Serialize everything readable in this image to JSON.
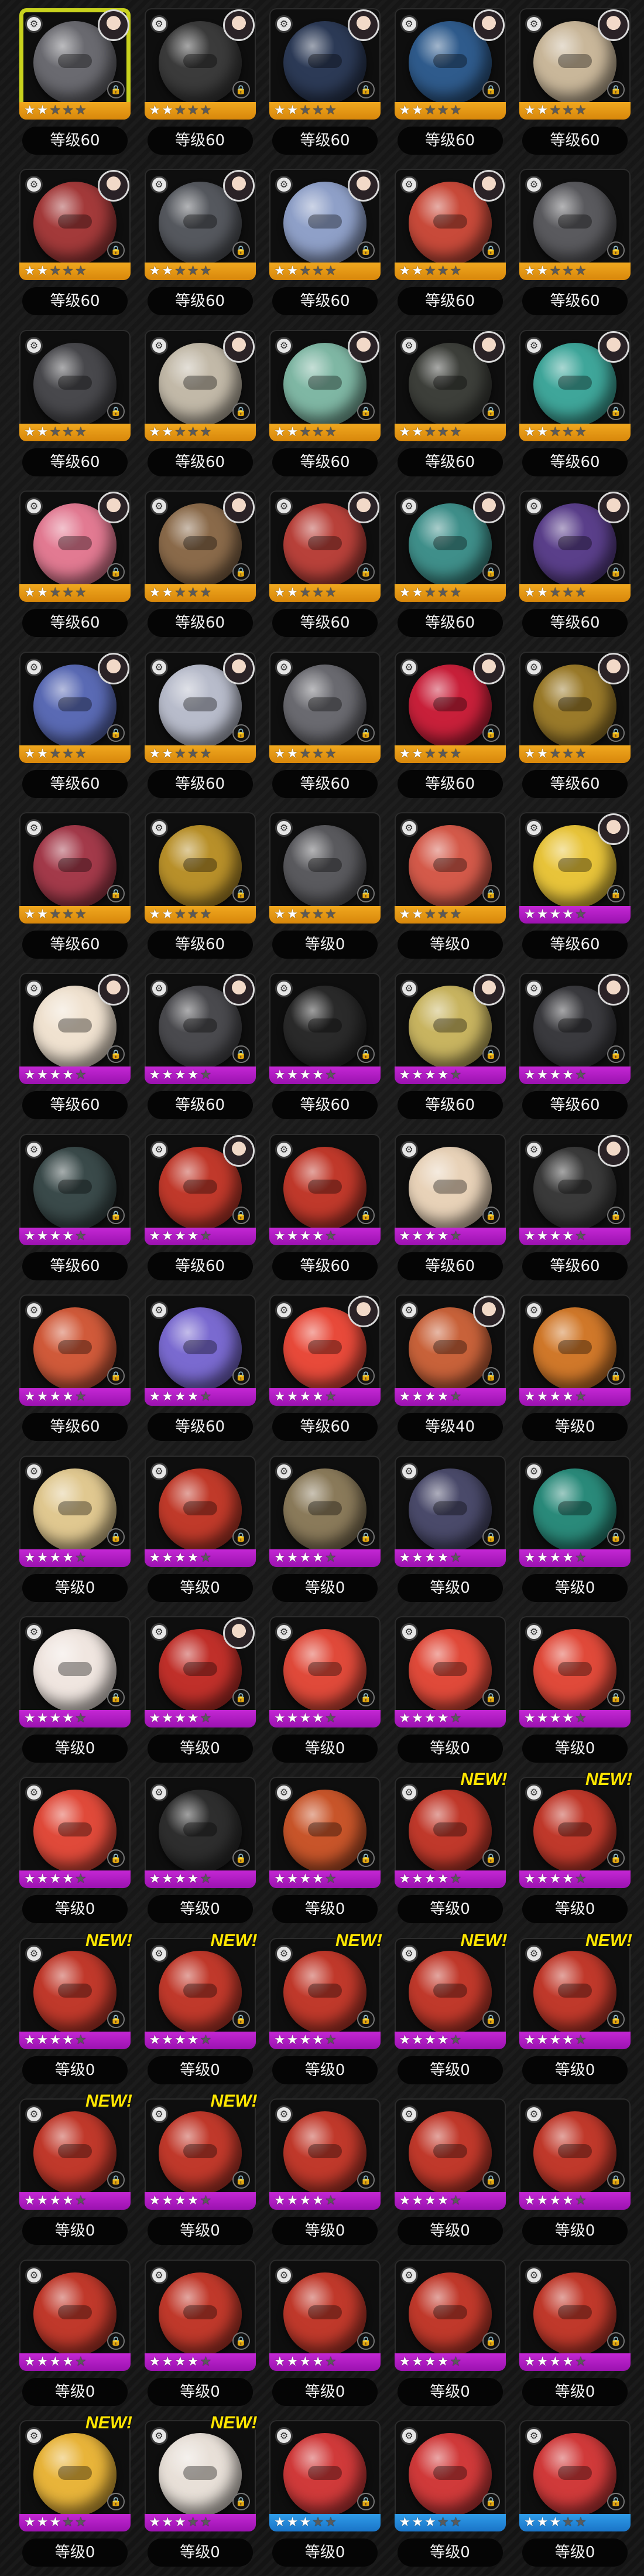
{
  "colors": {
    "selection_border": "#c8d21e",
    "rarity_orange": "#f0a81f",
    "rarity_purple": "#c427d4",
    "rarity_blue": "#2f9dea",
    "new_badge": "#ffe600"
  },
  "new_badge_text": "NEW!",
  "icons": {
    "type": "type-icon",
    "lock": "lock-icon",
    "star": "star-icon",
    "avatar": "character-avatar"
  },
  "items": [
    {
      "level": "等级60",
      "rarity": "orange",
      "stars": 2,
      "avatar": true,
      "new": false,
      "selected": true,
      "art": "#6a6a70"
    },
    {
      "level": "等级60",
      "rarity": "orange",
      "stars": 2,
      "avatar": true,
      "new": false,
      "art": "#3b3b3b"
    },
    {
      "level": "等级60",
      "rarity": "orange",
      "stars": 2,
      "avatar": true,
      "new": false,
      "art": "#2c3a56"
    },
    {
      "level": "等级60",
      "rarity": "orange",
      "stars": 2,
      "avatar": true,
      "new": false,
      "art": "#2f5b8c"
    },
    {
      "level": "等级60",
      "rarity": "orange",
      "stars": 2,
      "avatar": true,
      "new": false,
      "art": "#c9b79a"
    },
    {
      "level": "等级60",
      "rarity": "orange",
      "stars": 2,
      "avatar": true,
      "new": false,
      "art": "#a33a3a"
    },
    {
      "level": "等级60",
      "rarity": "orange",
      "stars": 2,
      "avatar": true,
      "new": false,
      "art": "#55585e"
    },
    {
      "level": "等级60",
      "rarity": "orange",
      "stars": 2,
      "avatar": true,
      "new": false,
      "art": "#8fa0c8"
    },
    {
      "level": "等级60",
      "rarity": "orange",
      "stars": 2,
      "avatar": true,
      "new": false,
      "art": "#c84a3a"
    },
    {
      "level": "等级60",
      "rarity": "orange",
      "stars": 2,
      "avatar": false,
      "new": false,
      "art": "#5a5a5e"
    },
    {
      "level": "等级60",
      "rarity": "orange",
      "stars": 2,
      "avatar": false,
      "new": false,
      "art": "#48484c"
    },
    {
      "level": "等级60",
      "rarity": "orange",
      "stars": 2,
      "avatar": true,
      "new": false,
      "art": "#c2b9a8"
    },
    {
      "level": "等级60",
      "rarity": "orange",
      "stars": 2,
      "avatar": true,
      "new": false,
      "art": "#7fb7a4"
    },
    {
      "level": "等级60",
      "rarity": "orange",
      "stars": 2,
      "avatar": true,
      "new": false,
      "art": "#3d3f3a"
    },
    {
      "level": "等级60",
      "rarity": "orange",
      "stars": 2,
      "avatar": true,
      "new": false,
      "art": "#3fa69a"
    },
    {
      "level": "等级60",
      "rarity": "orange",
      "stars": 2,
      "avatar": true,
      "new": false,
      "art": "#e27a92"
    },
    {
      "level": "等级60",
      "rarity": "orange",
      "stars": 2,
      "avatar": true,
      "new": false,
      "art": "#8a6a4a"
    },
    {
      "level": "等级60",
      "rarity": "orange",
      "stars": 2,
      "avatar": true,
      "new": false,
      "art": "#b8413a"
    },
    {
      "level": "等级60",
      "rarity": "orange",
      "stars": 2,
      "avatar": true,
      "new": false,
      "art": "#3f8f8a"
    },
    {
      "level": "等级60",
      "rarity": "orange",
      "stars": 2,
      "avatar": true,
      "new": false,
      "art": "#5a3f8a"
    },
    {
      "level": "等级60",
      "rarity": "orange",
      "stars": 2,
      "avatar": true,
      "new": false,
      "art": "#5a6ab4"
    },
    {
      "level": "等级60",
      "rarity": "orange",
      "stars": 2,
      "avatar": true,
      "new": false,
      "art": "#b8bccb"
    },
    {
      "level": "等级60",
      "rarity": "orange",
      "stars": 2,
      "avatar": false,
      "new": false,
      "art": "#6a6a70"
    },
    {
      "level": "等级60",
      "rarity": "orange",
      "stars": 2,
      "avatar": true,
      "new": false,
      "art": "#c8203a"
    },
    {
      "level": "等级60",
      "rarity": "orange",
      "stars": 2,
      "avatar": true,
      "new": false,
      "art": "#9a7a2a"
    },
    {
      "level": "等级60",
      "rarity": "orange",
      "stars": 2,
      "avatar": false,
      "new": false,
      "art": "#a33a4a"
    },
    {
      "level": "等级60",
      "rarity": "orange",
      "stars": 2,
      "avatar": false,
      "new": false,
      "art": "#b8902a"
    },
    {
      "level": "等级0",
      "rarity": "orange",
      "stars": 2,
      "avatar": false,
      "new": false,
      "art": "#5a5a5e"
    },
    {
      "level": "等级0",
      "rarity": "orange",
      "stars": 2,
      "avatar": false,
      "new": false,
      "art": "#d45a4a"
    },
    {
      "level": "等级60",
      "rarity": "purple",
      "stars": 4,
      "avatar": true,
      "new": false,
      "art": "#e8c43a"
    },
    {
      "level": "等级60",
      "rarity": "purple",
      "stars": 4,
      "avatar": true,
      "new": false,
      "art": "#f0e2d0"
    },
    {
      "level": "等级60",
      "rarity": "purple",
      "stars": 4,
      "avatar": true,
      "new": false,
      "art": "#4a4a4e"
    },
    {
      "level": "等级60",
      "rarity": "purple",
      "stars": 4,
      "avatar": false,
      "new": false,
      "art": "#2a2a2a"
    },
    {
      "level": "等级60",
      "rarity": "purple",
      "stars": 4,
      "avatar": true,
      "new": false,
      "art": "#c8b460"
    },
    {
      "level": "等级60",
      "rarity": "purple",
      "stars": 4,
      "avatar": true,
      "new": false,
      "art": "#3a3a3e"
    },
    {
      "level": "等级60",
      "rarity": "purple",
      "stars": 4,
      "avatar": false,
      "new": false,
      "art": "#3a4a4a"
    },
    {
      "level": "等级60",
      "rarity": "purple",
      "stars": 4,
      "avatar": true,
      "new": false,
      "art": "#c0392b"
    },
    {
      "level": "等级60",
      "rarity": "purple",
      "stars": 4,
      "avatar": false,
      "new": false,
      "art": "#c0392b"
    },
    {
      "level": "等级60",
      "rarity": "purple",
      "stars": 4,
      "avatar": false,
      "new": false,
      "art": "#e8d2b8"
    },
    {
      "level": "等级60",
      "rarity": "purple",
      "stars": 4,
      "avatar": true,
      "new": false,
      "art": "#3a3a3a"
    },
    {
      "level": "等级60",
      "rarity": "purple",
      "stars": 4,
      "avatar": false,
      "new": false,
      "art": "#d05a3a"
    },
    {
      "level": "等级60",
      "rarity": "purple",
      "stars": 4,
      "avatar": false,
      "new": false,
      "art": "#7a6ad0"
    },
    {
      "level": "等级60",
      "rarity": "purple",
      "stars": 4,
      "avatar": true,
      "new": false,
      "art": "#e84a3a"
    },
    {
      "level": "等级40",
      "rarity": "purple",
      "stars": 4,
      "avatar": true,
      "new": false,
      "art": "#c8623a"
    },
    {
      "level": "等级0",
      "rarity": "purple",
      "stars": 4,
      "avatar": false,
      "new": false,
      "art": "#d0782a"
    },
    {
      "level": "等级0",
      "rarity": "purple",
      "stars": 4,
      "avatar": false,
      "new": false,
      "art": "#e0c890"
    },
    {
      "level": "等级0",
      "rarity": "purple",
      "stars": 4,
      "avatar": false,
      "new": false,
      "art": "#c03a2a"
    },
    {
      "level": "等级0",
      "rarity": "purple",
      "stars": 4,
      "avatar": false,
      "new": false,
      "art": "#8a7a5a"
    },
    {
      "level": "等级0",
      "rarity": "purple",
      "stars": 4,
      "avatar": false,
      "new": false,
      "art": "#4a4a6a"
    },
    {
      "level": "等级0",
      "rarity": "purple",
      "stars": 4,
      "avatar": false,
      "new": false,
      "art": "#2a8a7a"
    },
    {
      "level": "等级0",
      "rarity": "purple",
      "stars": 4,
      "avatar": false,
      "new": false,
      "art": "#f0e6e0"
    },
    {
      "level": "等级0",
      "rarity": "purple",
      "stars": 4,
      "avatar": true,
      "new": false,
      "art": "#c0302a"
    },
    {
      "level": "等级0",
      "rarity": "purple",
      "stars": 4,
      "avatar": false,
      "new": false,
      "art": "#e04a3a"
    },
    {
      "level": "等级0",
      "rarity": "purple",
      "stars": 4,
      "avatar": false,
      "new": false,
      "art": "#e04a3a"
    },
    {
      "level": "等级0",
      "rarity": "purple",
      "stars": 4,
      "avatar": false,
      "new": false,
      "art": "#e04a3a"
    },
    {
      "level": "等级0",
      "rarity": "purple",
      "stars": 4,
      "avatar": false,
      "new": false,
      "art": "#e04a3a"
    },
    {
      "level": "等级0",
      "rarity": "purple",
      "stars": 4,
      "avatar": false,
      "new": false,
      "art": "#2e2e2e"
    },
    {
      "level": "等级0",
      "rarity": "purple",
      "stars": 4,
      "avatar": false,
      "new": false,
      "art": "#c8552a"
    },
    {
      "level": "等级0",
      "rarity": "purple",
      "stars": 4,
      "avatar": false,
      "new": true,
      "art": "#c0392b"
    },
    {
      "level": "等级0",
      "rarity": "purple",
      "stars": 4,
      "avatar": false,
      "new": true,
      "art": "#c0392b"
    },
    {
      "level": "等级0",
      "rarity": "purple",
      "stars": 4,
      "avatar": false,
      "new": true,
      "art": "#c0392b"
    },
    {
      "level": "等级0",
      "rarity": "purple",
      "stars": 4,
      "avatar": false,
      "new": true,
      "art": "#c0392b"
    },
    {
      "level": "等级0",
      "rarity": "purple",
      "stars": 4,
      "avatar": false,
      "new": true,
      "art": "#c0392b"
    },
    {
      "level": "等级0",
      "rarity": "purple",
      "stars": 4,
      "avatar": false,
      "new": true,
      "art": "#c0392b"
    },
    {
      "level": "等级0",
      "rarity": "purple",
      "stars": 4,
      "avatar": false,
      "new": true,
      "art": "#c0392b"
    },
    {
      "level": "等级0",
      "rarity": "purple",
      "stars": 4,
      "avatar": false,
      "new": true,
      "art": "#c0392b"
    },
    {
      "level": "等级0",
      "rarity": "purple",
      "stars": 4,
      "avatar": false,
      "new": true,
      "art": "#c0392b"
    },
    {
      "level": "等级0",
      "rarity": "purple",
      "stars": 4,
      "avatar": false,
      "new": false,
      "art": "#c0392b"
    },
    {
      "level": "等级0",
      "rarity": "purple",
      "stars": 4,
      "avatar": false,
      "new": false,
      "art": "#c0392b"
    },
    {
      "level": "等级0",
      "rarity": "purple",
      "stars": 4,
      "avatar": false,
      "new": false,
      "art": "#c0392b"
    },
    {
      "level": "等级0",
      "rarity": "purple",
      "stars": 4,
      "avatar": false,
      "new": false,
      "art": "#c0392b"
    },
    {
      "level": "等级0",
      "rarity": "purple",
      "stars": 4,
      "avatar": false,
      "new": false,
      "art": "#c0392b"
    },
    {
      "level": "等级0",
      "rarity": "purple",
      "stars": 4,
      "avatar": false,
      "new": false,
      "art": "#c0392b"
    },
    {
      "level": "等级0",
      "rarity": "purple",
      "stars": 4,
      "avatar": false,
      "new": false,
      "art": "#c0392b"
    },
    {
      "level": "等级0",
      "rarity": "purple",
      "stars": 4,
      "avatar": false,
      "new": false,
      "art": "#c0392b"
    },
    {
      "level": "等级0",
      "rarity": "purple",
      "stars": 3,
      "avatar": false,
      "new": true,
      "art": "#e8b43a"
    },
    {
      "level": "等级0",
      "rarity": "purple",
      "stars": 3,
      "avatar": false,
      "new": true,
      "art": "#e8e0d8"
    },
    {
      "level": "等级0",
      "rarity": "blue",
      "stars": 3,
      "avatar": false,
      "new": false,
      "art": "#d03a3a"
    },
    {
      "level": "等级0",
      "rarity": "blue",
      "stars": 3,
      "avatar": false,
      "new": false,
      "art": "#d03a3a"
    },
    {
      "level": "等级0",
      "rarity": "blue",
      "stars": 3,
      "avatar": false,
      "new": false,
      "art": "#d03a3a"
    }
  ]
}
